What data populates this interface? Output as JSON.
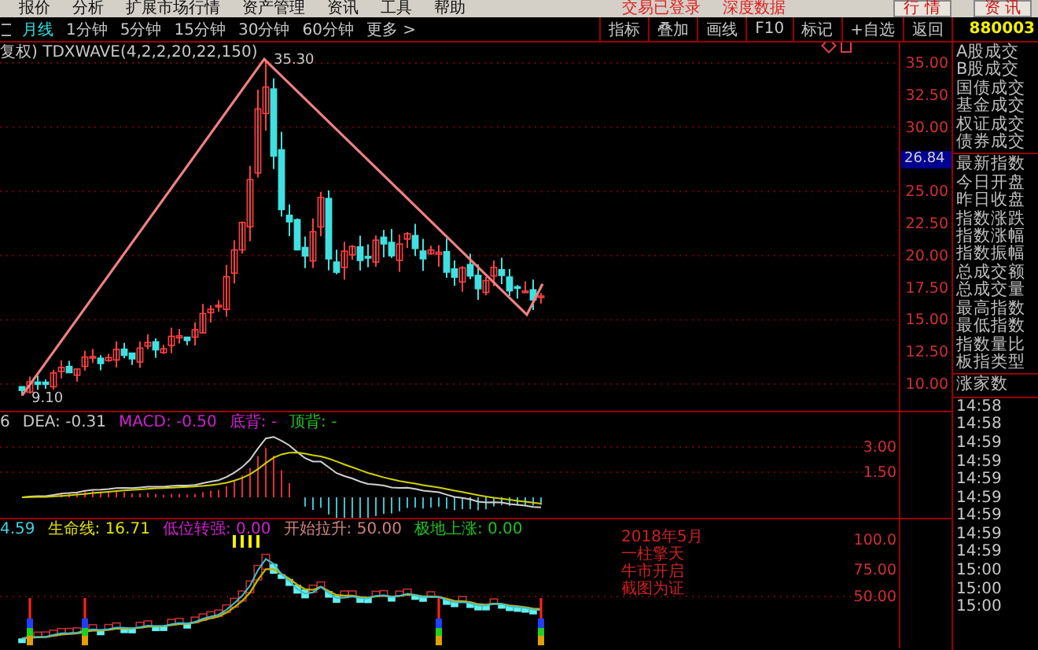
{
  "menu_bar": {
    "items": [
      "报价",
      "分析",
      "扩展市场行情",
      "资产管理",
      "资讯",
      "工具",
      "帮助"
    ],
    "status": [
      "交易已登录",
      "深度数据"
    ],
    "buttons": [
      "行 情",
      "资 讯"
    ]
  },
  "period_tabs": [
    {
      "label": "月线",
      "selected": true
    },
    {
      "label": "1分钟",
      "selected": false
    },
    {
      "label": "5分钟",
      "selected": false
    },
    {
      "label": "15分钟",
      "selected": false
    },
    {
      "label": "30分钟",
      "selected": false
    },
    {
      "label": "60分钟",
      "selected": false
    },
    {
      "label": "更多 >",
      "selected": false
    }
  ],
  "toolbar": [
    "指标",
    "叠加",
    "画线",
    "F10",
    "标记",
    "+自选",
    "返回"
  ],
  "main_chart": {
    "title": "复权) TDXWAVE(4,2,2,20,22,150)",
    "high_label": "35.30",
    "low_label": "9.10",
    "axis_upper": [
      "35.00",
      "32.50",
      "30.00"
    ],
    "axis_lower": [
      "25.00",
      "22.50",
      "20.00",
      "17.50",
      "15.00",
      "12.50",
      "10.00"
    ],
    "current_price": "26.84"
  },
  "macd_panel": {
    "readings": [
      {
        "text": "6",
        "color": "#c8c8c8"
      },
      {
        "text": "DEA: -0.31",
        "color": "#c8c8c8"
      },
      {
        "text": "MACD: -0.50",
        "color": "#d020d0"
      },
      {
        "text": "底背: -",
        "color": "#d020d0"
      },
      {
        "text": "顶背: -",
        "color": "#20c020"
      }
    ],
    "axis": [
      "3.00",
      "1.50"
    ]
  },
  "signal_panel": {
    "readings": [
      {
        "text": "4.59",
        "color": "#40d0e0"
      },
      {
        "text": "生命线: 16.71",
        "color": "#e0e000"
      },
      {
        "text": "低位转强: 0.00",
        "color": "#d020d0"
      },
      {
        "text": "开始拉升: 50.00",
        "color": "#d08080"
      },
      {
        "text": "极地上涨: 0.00",
        "color": "#20c020"
      }
    ],
    "note": [
      "2018年5月",
      "一柱擎天",
      "牛市开启",
      "截图为证"
    ],
    "axis": [
      "100.0",
      "75.00",
      "50.00"
    ]
  },
  "side_panel": {
    "code": "880003",
    "groups": [
      [
        "A股成交",
        "B股成交",
        "国债成交",
        "基金成交",
        "权证成交",
        "债券成交"
      ],
      [
        "最新指数",
        "今日开盘",
        "昨日收盘",
        "指数涨跌",
        "指数涨幅",
        "指数振幅",
        "总成交额",
        "总成交量",
        "最高指数",
        "最低指数",
        "指数量比",
        "板指类型"
      ],
      [
        "涨家数"
      ]
    ],
    "times": [
      "14:58",
      "14:58",
      "14:59",
      "14:59",
      "14:59",
      "14:59",
      "14:59",
      "14:59",
      "14:59",
      "15:00",
      "15:00",
      "15:00"
    ]
  }
}
